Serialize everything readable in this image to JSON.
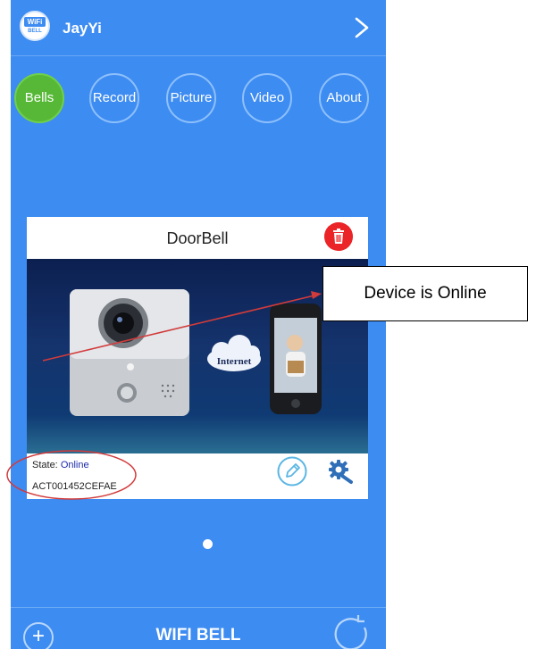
{
  "header": {
    "logo_line1": "WiFi",
    "logo_line2": "BELL",
    "username": "JayYi"
  },
  "tabs": [
    {
      "label": "Bells",
      "active": true
    },
    {
      "label": "Record",
      "active": false
    },
    {
      "label": "Picture",
      "active": false
    },
    {
      "label": "Video",
      "active": false
    },
    {
      "label": "About",
      "active": false
    }
  ],
  "device_card": {
    "title": "DoorBell",
    "image_cloud_label": "Internet",
    "state_label": "State:",
    "state_value": "Online",
    "device_id": "ACT001452CEFAE"
  },
  "footer": {
    "title": "WIFI BELL"
  },
  "annotation": {
    "callout_text": "Device is Online"
  },
  "colors": {
    "background": "#3d8cf2",
    "active_tab": "#56b836",
    "delete_button": "#ea2427",
    "annotation_red": "#d23b3b"
  },
  "icons": [
    "wifi-bell-logo-icon",
    "chevron-right-icon",
    "trash-icon",
    "edit-pencil-icon",
    "settings-gear-icon",
    "plus-icon",
    "refresh-icon"
  ]
}
